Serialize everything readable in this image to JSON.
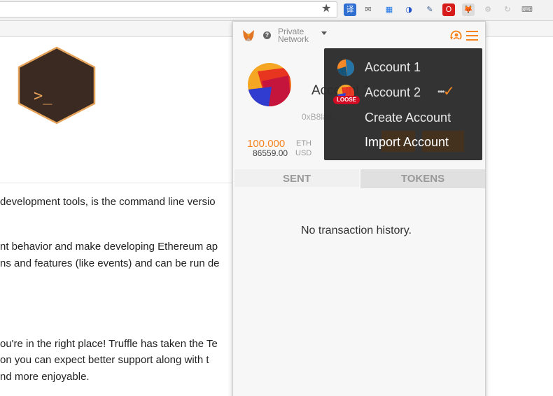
{
  "browser": {
    "star_icon": "★",
    "extensions": [
      {
        "name": "translate-ext-icon",
        "glyph": "译",
        "color": "#ffffff",
        "bg": "#2e6fd1"
      },
      {
        "name": "mail-ext-icon",
        "glyph": "✉",
        "color": "#666666",
        "bg": "transparent"
      },
      {
        "name": "calendar-ext-icon",
        "glyph": "▦",
        "color": "#1a73e8",
        "bg": "transparent"
      },
      {
        "name": "sync-ext-icon",
        "glyph": "◑",
        "color": "#2255cc",
        "bg": "transparent"
      },
      {
        "name": "dropper-ext-icon",
        "glyph": "✎",
        "color": "#3b5e8c",
        "bg": "transparent"
      },
      {
        "name": "opera-ext-icon",
        "glyph": "O",
        "color": "#ffffff",
        "bg": "#d71a1a"
      },
      {
        "name": "metamask-ext-icon",
        "glyph": "🦊",
        "color": "#f5841f",
        "bg": "#dcdcdc"
      },
      {
        "name": "gear-ext-icon",
        "glyph": "⚙",
        "color": "#bbbbbb",
        "bg": "transparent"
      },
      {
        "name": "refresh-ext-icon",
        "glyph": "↻",
        "color": "#bbbbbb",
        "bg": "transparent"
      },
      {
        "name": "keyboard-ext-icon",
        "glyph": "⌨",
        "color": "#777777",
        "bg": "transparent"
      }
    ]
  },
  "page": {
    "logo_text": ">_",
    "lines": [
      "development tools, is the command line versio",
      "nt behavior and make developing Ethereum ap",
      "ns and features (like events) and can be run de",
      "ou're in the right place! Truffle has taken the Te",
      " on you can expect better support along with t",
      "nd more enjoyable."
    ]
  },
  "popup": {
    "network_line1": "Private",
    "network_line2": "Network",
    "help_glyph": "?",
    "account_name": "Account 2",
    "address": "0xB8la9...",
    "eth_balance": "100.000",
    "eth_unit": "ETH",
    "usd_balance": "86559.00",
    "usd_unit": "USD",
    "tabs": {
      "sent": "SENT",
      "tokens": "TOKENS"
    },
    "no_history": "No transaction history."
  },
  "dropdown": {
    "items": [
      "Account 1",
      "Account 2",
      "Create Account",
      "Import Account"
    ],
    "loose_badge": "LOOSE",
    "dots": "•••",
    "check": "✓"
  },
  "colors": {
    "accent": "#f5841f",
    "dropdown_bg": "#2c2c2c",
    "badge_red": "#d0021b"
  }
}
